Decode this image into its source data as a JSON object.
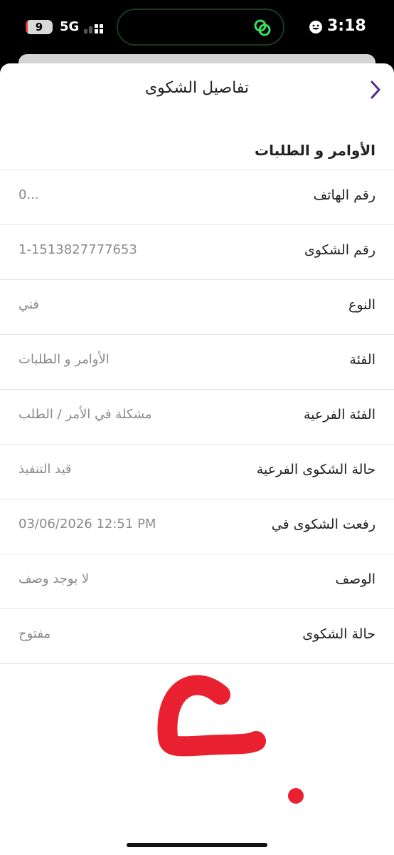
{
  "status_bar": {
    "battery": "9",
    "battery_level": 0.09,
    "network": "5G",
    "time": "3:18"
  },
  "header": {
    "title": "تفاصيل الشكوى",
    "back_icon": "chevron-right-icon"
  },
  "section": {
    "title": "الأوامر و الطلبات"
  },
  "rows": [
    {
      "label": "رقم الهاتف",
      "value": "0..."
    },
    {
      "label": "رقم الشكوى",
      "value": "1-1513827777653"
    },
    {
      "label": "النوع",
      "value": "فني"
    },
    {
      "label": "الفئة",
      "value": "الأوامر و الطلبات"
    },
    {
      "label": "الفئة الفرعية",
      "value": "مشكلة في الأمر / الطلب"
    },
    {
      "label": "حالة الشكوى الفرعية",
      "value": "قيد التنفيذ"
    },
    {
      "label": "رفعت الشكوى في",
      "value": "03/06/2026 12:51 PM"
    },
    {
      "label": "الوصف",
      "value": "لا يوجد وصف"
    },
    {
      "label": "حالة الشكوى",
      "value": "مفتوح"
    }
  ],
  "colors": {
    "accent": "#5b2a86",
    "annotation": "#e8202f",
    "value_text": "#8a8a8a"
  }
}
